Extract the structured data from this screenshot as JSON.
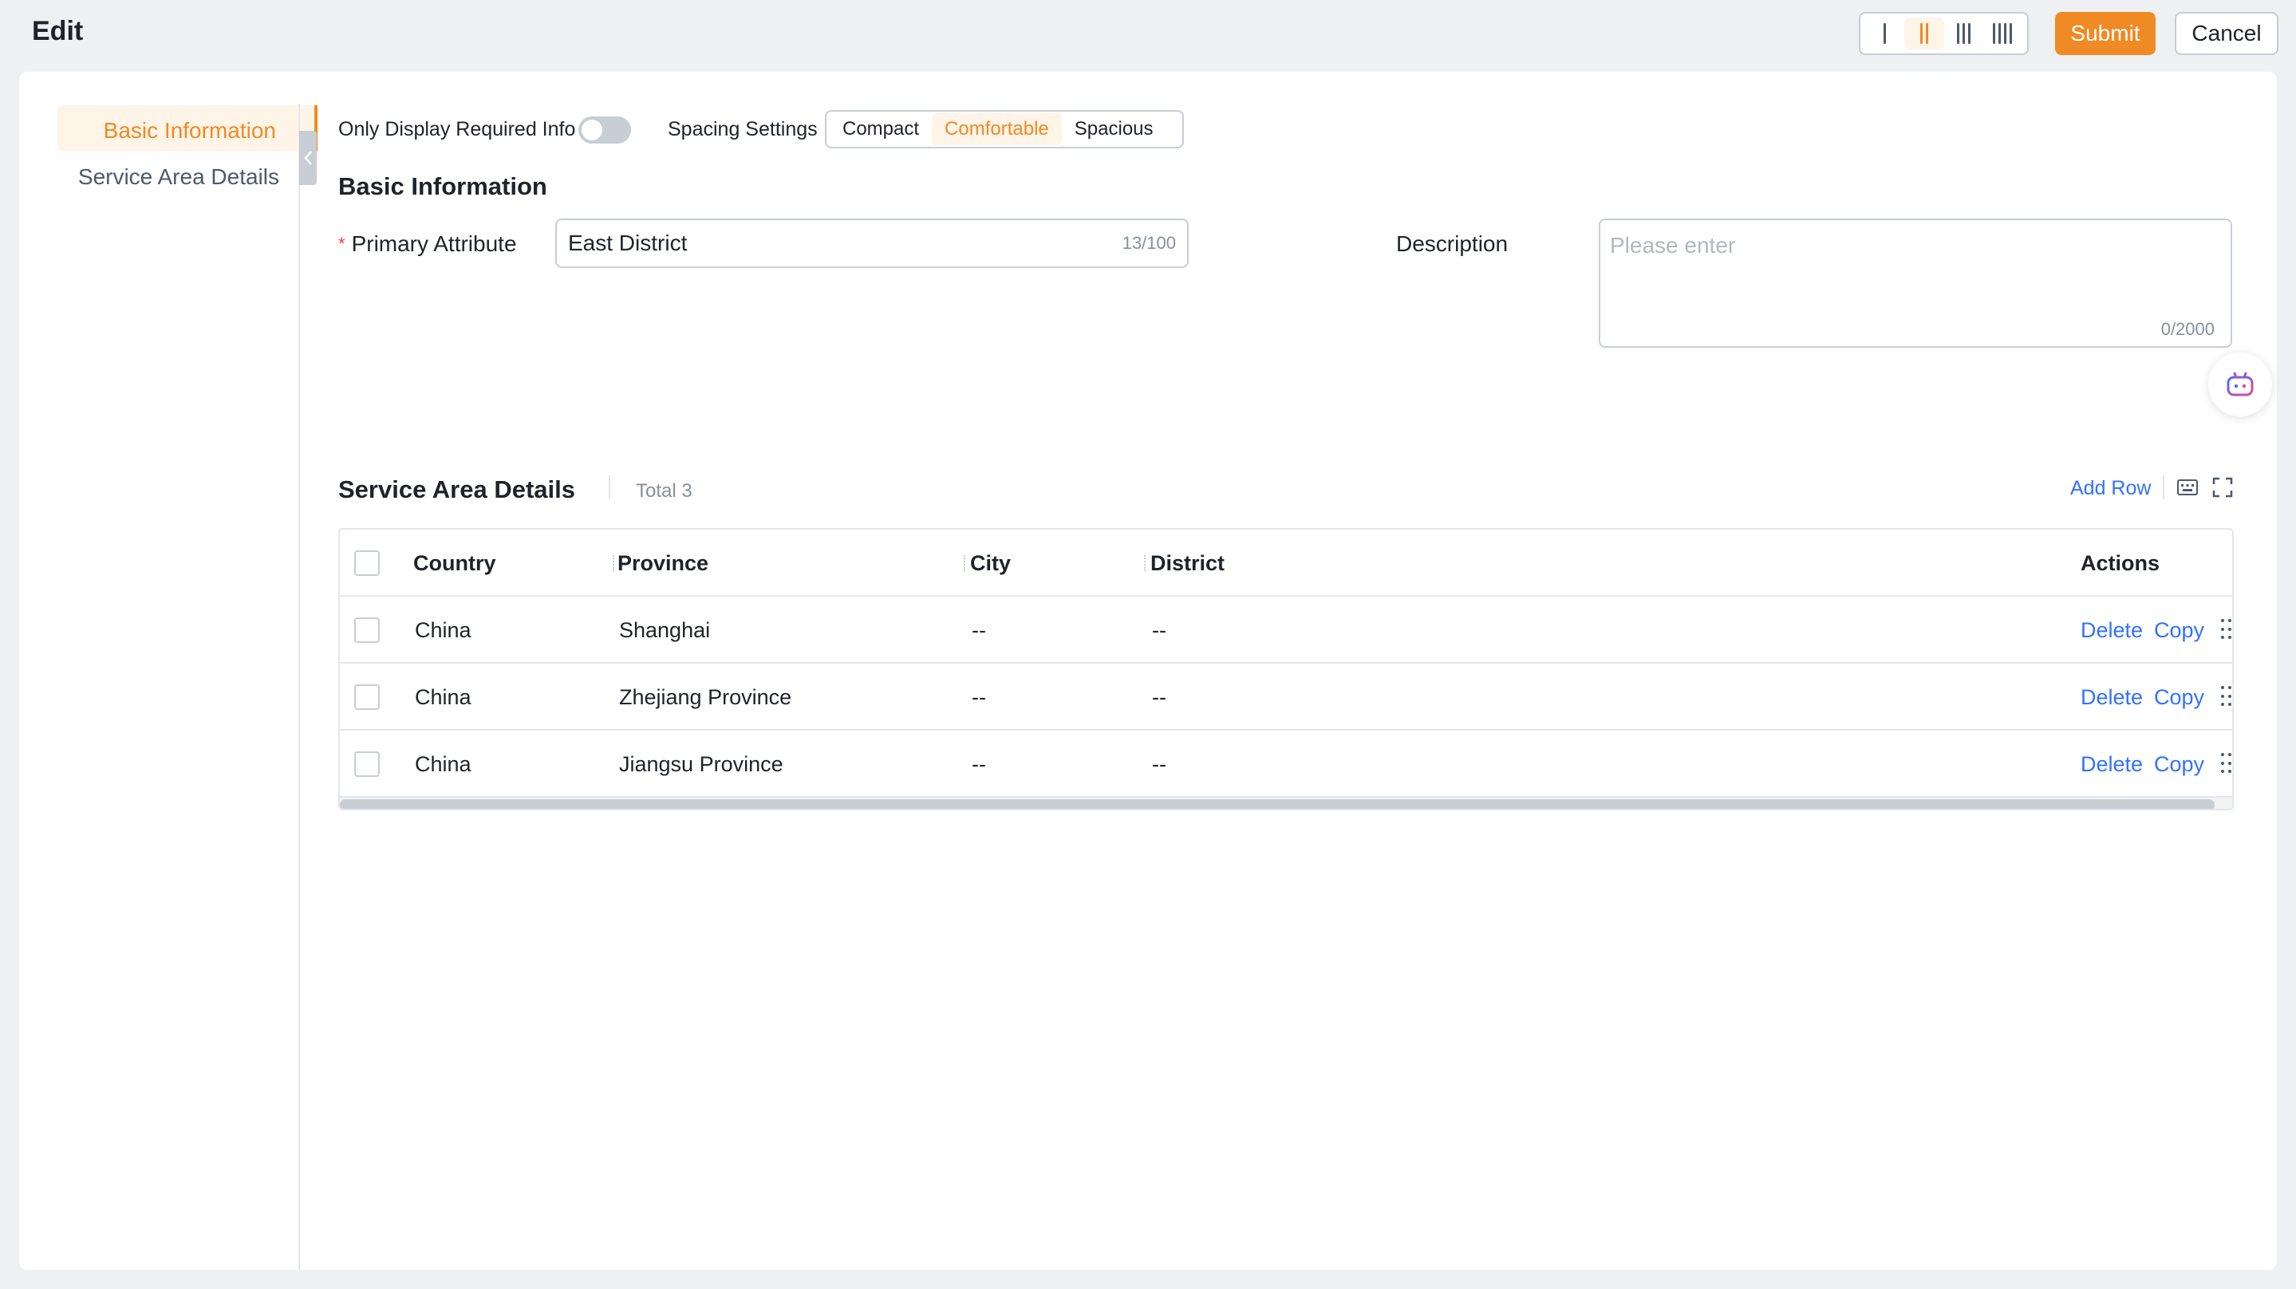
{
  "header": {
    "title": "Edit",
    "column_layout_options": [
      "one-column-icon",
      "two-column-icon",
      "three-column-icon",
      "four-column-icon"
    ],
    "column_layout_active": 2,
    "submit_label": "Submit",
    "cancel_label": "Cancel"
  },
  "anchor_nav": {
    "items": [
      {
        "label": "Basic Information",
        "active": true
      },
      {
        "label": "Service Area Details",
        "active": false
      }
    ],
    "collapse_icon": "chevron-left-icon"
  },
  "toolbar": {
    "required_only_label": "Only Display Required Info",
    "required_only_on": false,
    "spacing_label": "Spacing Settings",
    "spacing_options": [
      "Compact",
      "Comfortable",
      "Spacious"
    ],
    "spacing_selected": "Comfortable"
  },
  "basic_info": {
    "title": "Basic Information",
    "primary_attribute": {
      "label": "Primary Attribute",
      "required": true,
      "value": "East District",
      "count": "13/100"
    },
    "description": {
      "label": "Description",
      "placeholder": "Please enter",
      "count": "0/2000"
    },
    "ai_assistant_icon": "robot-icon"
  },
  "service_area": {
    "title": "Service Area Details",
    "total": "Total 3",
    "add_row_label": "Add Row",
    "tool_icons": [
      "keyboard-icon",
      "fullscreen-icon"
    ],
    "columns": [
      "Country",
      "Province",
      "City",
      "District",
      "Actions"
    ],
    "rows": [
      {
        "country": "China",
        "province": "Shanghai",
        "city": "--",
        "district": "--",
        "delete": "Delete",
        "copy": "Copy"
      },
      {
        "country": "China",
        "province": "Zhejiang Province",
        "city": "--",
        "district": "--",
        "delete": "Delete",
        "copy": "Copy"
      },
      {
        "country": "China",
        "province": "Jiangsu Province",
        "city": "--",
        "district": "--",
        "delete": "Delete",
        "copy": "Copy"
      }
    ]
  },
  "colors": {
    "accent": "#f08a24",
    "link": "#3370ff",
    "required": "#f53f3f",
    "page_bg": "#eff0f2"
  }
}
